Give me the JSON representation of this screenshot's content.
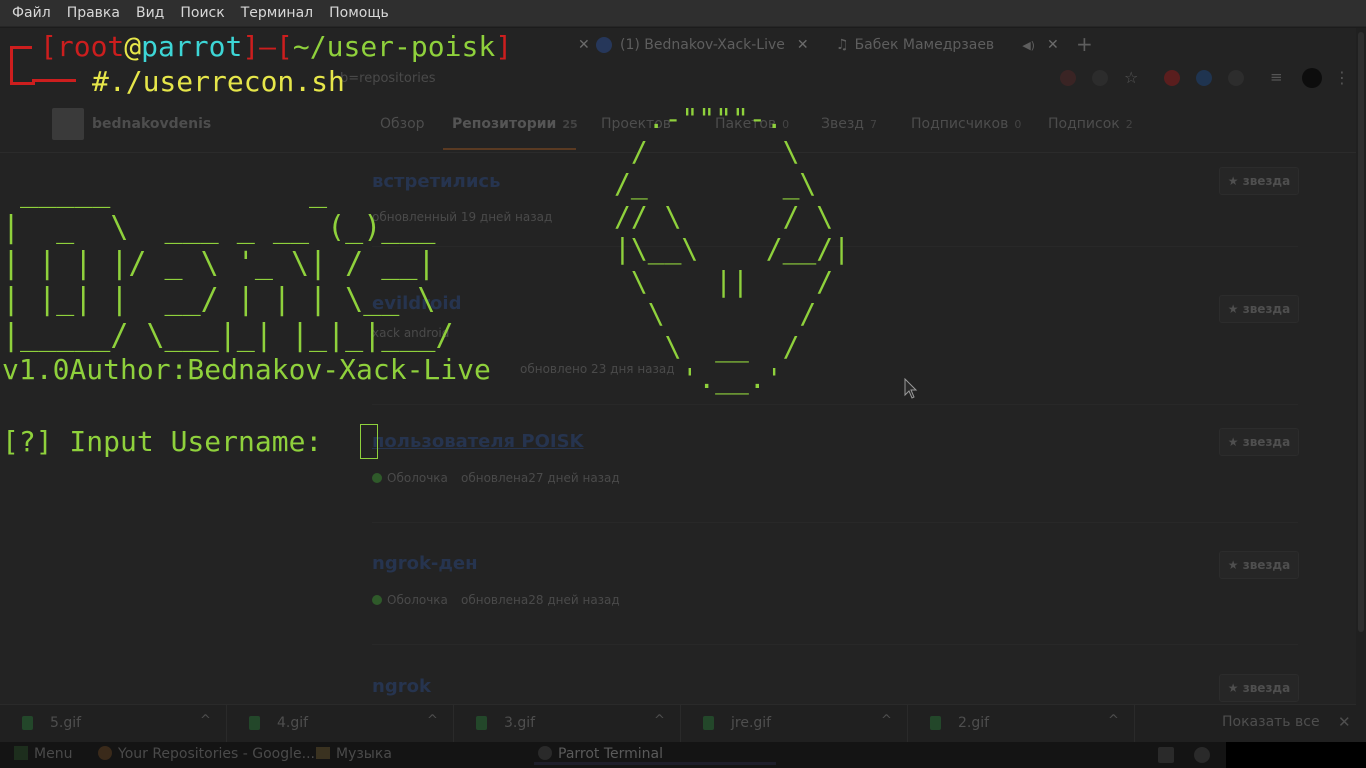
{
  "menubar": {
    "items": [
      "Файл",
      "Правка",
      "Вид",
      "Поиск",
      "Терминал",
      "Помощь"
    ]
  },
  "browser": {
    "tabs": [
      {
        "title": "(1) Bednakov-Xack-Live",
        "icon": "facebook-icon"
      },
      {
        "title": "Бабек Мамедрзаев",
        "icon": "music-note-icon"
      }
    ],
    "new_tab": "+",
    "url_fragment": "b=repositories",
    "profile": {
      "username": "bednakovdenis",
      "tabs": [
        {
          "label": "Обзор",
          "count": ""
        },
        {
          "label": "Репозитории",
          "count": "25"
        },
        {
          "label": "Проектов",
          "count": ""
        },
        {
          "label": "Пакетов",
          "count": "0"
        },
        {
          "label": "Звезд",
          "count": "7"
        },
        {
          "label": "Подписчиков",
          "count": "0"
        },
        {
          "label": "Подписок",
          "count": "2"
        }
      ]
    },
    "repos": [
      {
        "name": "встретились",
        "meta": "обновленный 19 дней назад",
        "star_label": "звезда"
      },
      {
        "name": "evildroid",
        "description": "xack android",
        "meta": "обновлено 23 дня назад",
        "star_label": "звезда"
      },
      {
        "name": "пользователя POISK",
        "language": "Оболочка",
        "meta": "обновлена27 дней назад",
        "star_label": "звезда"
      },
      {
        "name": "ngrok-ден",
        "language": "Оболочка",
        "meta": "обновлена28 дней назад",
        "star_label": "звезда"
      },
      {
        "name": "ngrok",
        "star_label": "звезда"
      }
    ],
    "downloads": {
      "items": [
        "5.gif",
        "4.gif",
        "3.gif",
        "jre.gif",
        "2.gif"
      ],
      "show_all": "Показать все",
      "close": "✕"
    }
  },
  "terminal": {
    "prompt": {
      "bracket_open": "[",
      "user": "root",
      "at": "@",
      "host": "parrot",
      "bracket_close": "]",
      "dash": "—",
      "path_open": "[",
      "path": "~/user-poisk",
      "path_close": "]",
      "symbol": "#",
      "command": "./userrecon.sh"
    },
    "banner": " _____           _\n|  _  \\  ___ _ __ (_)___\n| | | |/ _ \\ '_ \\| / __|\n| |_| |  __/ | | | \\__ \\\n|_____/ \\___|_| |_|_|___/",
    "version_line": "v1.0Author:Bednakov-Xack-Live",
    "input_prompt": "[?] Input Username: ",
    "alien": "  .-\"\"\"\"-.\n /        \\\n/_        _\\\n// \\      / \\\n|\\__\\    /__/|\n \\    ||    /\n  \\        /\n   \\  __  /\n    '.__.'"
  },
  "taskbar": {
    "menu_label": "Menu",
    "items": [
      "Your Repositories - Google...",
      "Музыка",
      "Parrot Terminal"
    ]
  },
  "colors": {
    "terminal_green": "#8fd13c",
    "prompt_red": "#cc1e1e",
    "prompt_cyan": "#3dd6d6",
    "prompt_yellow": "#e6e64a"
  }
}
